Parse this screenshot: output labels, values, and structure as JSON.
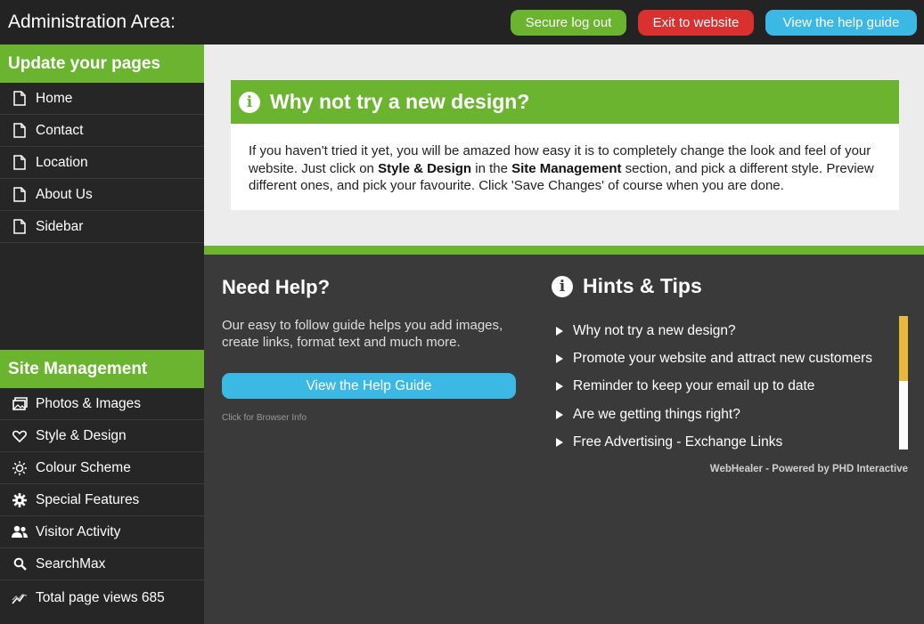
{
  "header": {
    "title": "Administration Area:",
    "buttons": {
      "logout": "Secure log out",
      "exit": "Exit to website",
      "help": "View the help guide"
    }
  },
  "sidebar": {
    "pages_heading": "Update your pages",
    "pages": [
      {
        "label": "Home",
        "icon": "page-icon"
      },
      {
        "label": "Contact",
        "icon": "page-icon"
      },
      {
        "label": "Location",
        "icon": "page-icon"
      },
      {
        "label": "About Us",
        "icon": "page-icon"
      },
      {
        "label": "Sidebar",
        "icon": "page-icon"
      }
    ],
    "site_heading": "Site Management",
    "site": [
      {
        "label": "Photos & Images",
        "icon": "photos-icon"
      },
      {
        "label": "Style & Design",
        "icon": "heart-icon"
      },
      {
        "label": "Colour Scheme",
        "icon": "sun-icon"
      },
      {
        "label": "Special Features",
        "icon": "gear-icon"
      },
      {
        "label": "Visitor Activity",
        "icon": "users-icon"
      },
      {
        "label": "SearchMax",
        "icon": "search-icon"
      },
      {
        "label": "Total page views 685",
        "icon": "chart-icon"
      }
    ]
  },
  "tip": {
    "title": "Why not try a new design?",
    "body_1": "If you haven't tried it yet, you will be amazed how easy it is to completely change the look and feel of your website. Just click on ",
    "bold_1": "Style & Design",
    "body_2": " in the ",
    "bold_2": "Site Management",
    "body_3": " section, and pick a different style. Preview different ones, and pick your favourite. Click 'Save Changes' of course when you are done."
  },
  "help": {
    "title": "Need Help?",
    "text": "Our easy to follow guide helps you add images, create links, format text and much more.",
    "button": "View the Help Guide",
    "browser_info": "Click for Browser Info"
  },
  "hints": {
    "title": "Hints & Tips",
    "items": [
      "Why not try a new design?",
      "Promote your website and attract new customers",
      "Reminder to keep your email up to date",
      "Are we getting things right?",
      "Free Advertising - Exchange Links"
    ]
  },
  "footer": {
    "powered": "WebHealer - Powered by PHD Interactive"
  },
  "colors": {
    "green": "#6ab42f",
    "red": "#d93030",
    "blue": "#3cb8e4",
    "scroll": "#e8b83a"
  }
}
